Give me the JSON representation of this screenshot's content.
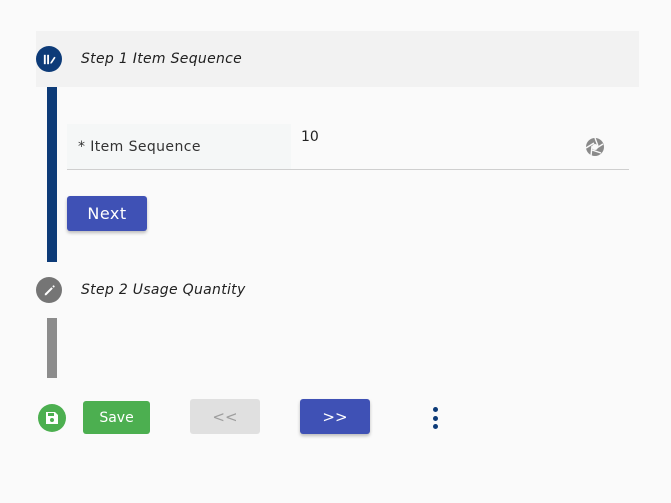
{
  "stepper": {
    "step1": {
      "title": "Step 1 Item Sequence",
      "icon": "step-active-icon"
    },
    "step2": {
      "title": "Step 2 Usage Quantity",
      "icon": "pencil-icon"
    }
  },
  "form": {
    "item_sequence": {
      "label": "* Item Sequence",
      "value": "10",
      "icon": "aperture-icon"
    },
    "next_label": "Next"
  },
  "footer": {
    "save_icon": "floppy-disk-icon",
    "save_label": "Save",
    "prev_label": "<<",
    "next_label": ">>",
    "more_icon": "more-vertical-icon"
  },
  "colors": {
    "primary": "#3f51b5",
    "step_active": "#0d3b78",
    "step_inactive": "#757575",
    "success": "#4caf50",
    "disabled": "#e0e0e0"
  }
}
